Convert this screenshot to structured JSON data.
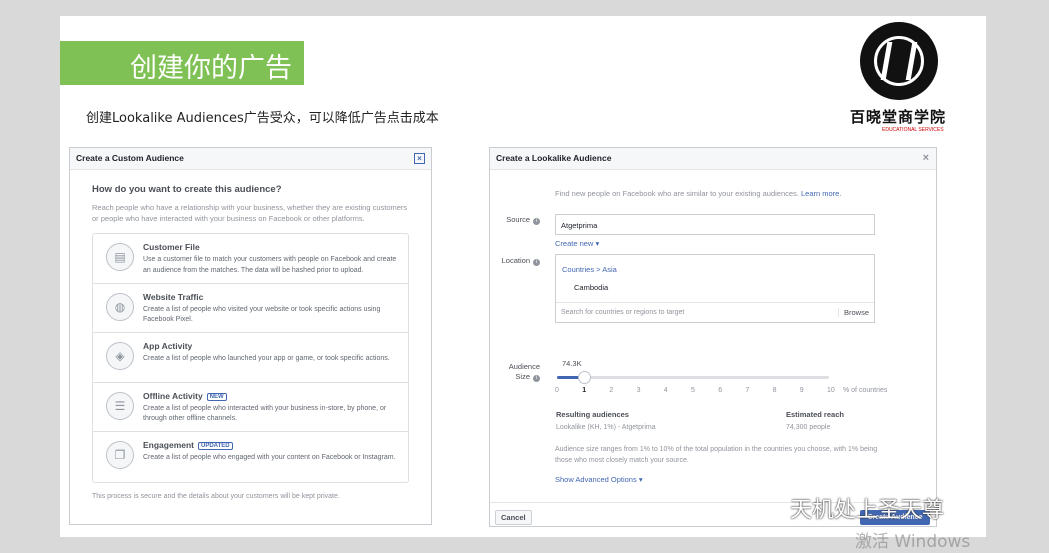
{
  "slide": {
    "title": "创建你的广告",
    "subtitle": "创建Lookalike Audiences广告受众，可以降低广告点击成本",
    "logo_name": "百晓堂商学院",
    "logo_sub": "EDUCATIONAL SERVICES",
    "accent_color": "#7fc155"
  },
  "custom_audience": {
    "header": "Create a Custom Audience",
    "question": "How do you want to create this audience?",
    "description": "Reach people who have a relationship with your business, whether they are existing customers or people who have interacted with your business on Facebook or other platforms.",
    "options": [
      {
        "icon": "contact-card-icon",
        "title": "Customer File",
        "badge": "",
        "desc": "Use a customer file to match your customers with people on Facebook and create an audience from the matches. The data will be hashed prior to upload."
      },
      {
        "icon": "globe-icon",
        "title": "Website Traffic",
        "badge": "",
        "desc": "Create a list of people who visited your website or took specific actions using Facebook Pixel."
      },
      {
        "icon": "cube-icon",
        "title": "App Activity",
        "badge": "",
        "desc": "Create a list of people who launched your app or game, or took specific actions."
      },
      {
        "icon": "store-icon",
        "title": "Offline Activity",
        "badge": "NEW",
        "desc": "Create a list of people who interacted with your business in-store, by phone, or through other offline channels."
      },
      {
        "icon": "engagement-icon",
        "title": "Engagement",
        "badge": "UPDATED",
        "desc": "Create a list of people who engaged with your content on Facebook or Instagram."
      }
    ],
    "footer": "This process is secure and the details about your customers will be kept private."
  },
  "lookalike": {
    "header": "Create a Lookalike Audience",
    "intro": "Find new people on Facebook who are similar to your existing audiences.",
    "intro_link": "Learn more.",
    "source_label": "Source",
    "source_value": "Atgetprima",
    "create_new": "Create new",
    "location_label": "Location",
    "location_path": "Countries > Asia",
    "location_country": "Cambodia",
    "location_placeholder": "Search for countries or regions to target",
    "browse": "Browse",
    "size_label_1": "Audience",
    "size_label_2": "Size",
    "size_value": "74.3K",
    "slider_level": 1,
    "slider_max": 10,
    "ticks": [
      "0",
      "1",
      "2",
      "3",
      "4",
      "5",
      "6",
      "7",
      "8",
      "9",
      "10"
    ],
    "pct_label": "% of countries",
    "resulting_header": "Resulting audiences",
    "resulting_value": "Lookalike (KH, 1%) - Atgetprima",
    "reach_header": "Estimated reach",
    "reach_value": "74,300 people",
    "size_note": "Audience size ranges from 1% to 10% of the total population in the countries you choose, with 1% being those who most closely match your source.",
    "advanced": "Show Advanced Options",
    "cancel": "Cancel",
    "create": "Create Audience"
  },
  "watermark": {
    "brand": "天机处上圣天尊",
    "activate": "激活 Windows"
  }
}
